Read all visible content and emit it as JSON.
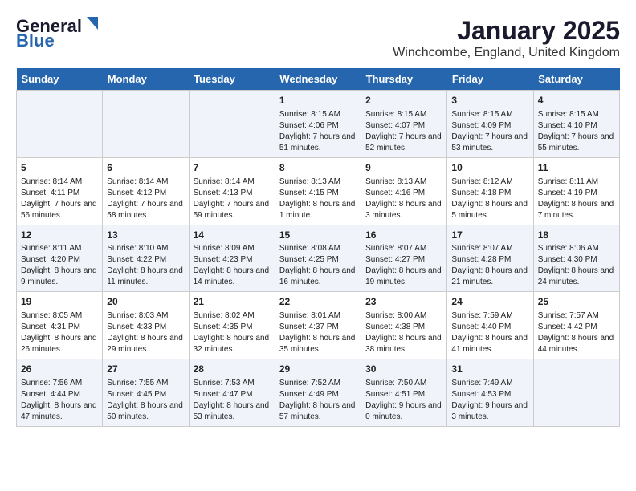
{
  "header": {
    "logo_general": "General",
    "logo_blue": "Blue",
    "title": "January 2025",
    "subtitle": "Winchcombe, England, United Kingdom"
  },
  "days_of_week": [
    "Sunday",
    "Monday",
    "Tuesday",
    "Wednesday",
    "Thursday",
    "Friday",
    "Saturday"
  ],
  "weeks": [
    [
      {
        "day": "",
        "info": ""
      },
      {
        "day": "",
        "info": ""
      },
      {
        "day": "",
        "info": ""
      },
      {
        "day": "1",
        "info": "Sunrise: 8:15 AM\nSunset: 4:06 PM\nDaylight: 7 hours and 51 minutes."
      },
      {
        "day": "2",
        "info": "Sunrise: 8:15 AM\nSunset: 4:07 PM\nDaylight: 7 hours and 52 minutes."
      },
      {
        "day": "3",
        "info": "Sunrise: 8:15 AM\nSunset: 4:09 PM\nDaylight: 7 hours and 53 minutes."
      },
      {
        "day": "4",
        "info": "Sunrise: 8:15 AM\nSunset: 4:10 PM\nDaylight: 7 hours and 55 minutes."
      }
    ],
    [
      {
        "day": "5",
        "info": "Sunrise: 8:14 AM\nSunset: 4:11 PM\nDaylight: 7 hours and 56 minutes."
      },
      {
        "day": "6",
        "info": "Sunrise: 8:14 AM\nSunset: 4:12 PM\nDaylight: 7 hours and 58 minutes."
      },
      {
        "day": "7",
        "info": "Sunrise: 8:14 AM\nSunset: 4:13 PM\nDaylight: 7 hours and 59 minutes."
      },
      {
        "day": "8",
        "info": "Sunrise: 8:13 AM\nSunset: 4:15 PM\nDaylight: 8 hours and 1 minute."
      },
      {
        "day": "9",
        "info": "Sunrise: 8:13 AM\nSunset: 4:16 PM\nDaylight: 8 hours and 3 minutes."
      },
      {
        "day": "10",
        "info": "Sunrise: 8:12 AM\nSunset: 4:18 PM\nDaylight: 8 hours and 5 minutes."
      },
      {
        "day": "11",
        "info": "Sunrise: 8:11 AM\nSunset: 4:19 PM\nDaylight: 8 hours and 7 minutes."
      }
    ],
    [
      {
        "day": "12",
        "info": "Sunrise: 8:11 AM\nSunset: 4:20 PM\nDaylight: 8 hours and 9 minutes."
      },
      {
        "day": "13",
        "info": "Sunrise: 8:10 AM\nSunset: 4:22 PM\nDaylight: 8 hours and 11 minutes."
      },
      {
        "day": "14",
        "info": "Sunrise: 8:09 AM\nSunset: 4:23 PM\nDaylight: 8 hours and 14 minutes."
      },
      {
        "day": "15",
        "info": "Sunrise: 8:08 AM\nSunset: 4:25 PM\nDaylight: 8 hours and 16 minutes."
      },
      {
        "day": "16",
        "info": "Sunrise: 8:07 AM\nSunset: 4:27 PM\nDaylight: 8 hours and 19 minutes."
      },
      {
        "day": "17",
        "info": "Sunrise: 8:07 AM\nSunset: 4:28 PM\nDaylight: 8 hours and 21 minutes."
      },
      {
        "day": "18",
        "info": "Sunrise: 8:06 AM\nSunset: 4:30 PM\nDaylight: 8 hours and 24 minutes."
      }
    ],
    [
      {
        "day": "19",
        "info": "Sunrise: 8:05 AM\nSunset: 4:31 PM\nDaylight: 8 hours and 26 minutes."
      },
      {
        "day": "20",
        "info": "Sunrise: 8:03 AM\nSunset: 4:33 PM\nDaylight: 8 hours and 29 minutes."
      },
      {
        "day": "21",
        "info": "Sunrise: 8:02 AM\nSunset: 4:35 PM\nDaylight: 8 hours and 32 minutes."
      },
      {
        "day": "22",
        "info": "Sunrise: 8:01 AM\nSunset: 4:37 PM\nDaylight: 8 hours and 35 minutes."
      },
      {
        "day": "23",
        "info": "Sunrise: 8:00 AM\nSunset: 4:38 PM\nDaylight: 8 hours and 38 minutes."
      },
      {
        "day": "24",
        "info": "Sunrise: 7:59 AM\nSunset: 4:40 PM\nDaylight: 8 hours and 41 minutes."
      },
      {
        "day": "25",
        "info": "Sunrise: 7:57 AM\nSunset: 4:42 PM\nDaylight: 8 hours and 44 minutes."
      }
    ],
    [
      {
        "day": "26",
        "info": "Sunrise: 7:56 AM\nSunset: 4:44 PM\nDaylight: 8 hours and 47 minutes."
      },
      {
        "day": "27",
        "info": "Sunrise: 7:55 AM\nSunset: 4:45 PM\nDaylight: 8 hours and 50 minutes."
      },
      {
        "day": "28",
        "info": "Sunrise: 7:53 AM\nSunset: 4:47 PM\nDaylight: 8 hours and 53 minutes."
      },
      {
        "day": "29",
        "info": "Sunrise: 7:52 AM\nSunset: 4:49 PM\nDaylight: 8 hours and 57 minutes."
      },
      {
        "day": "30",
        "info": "Sunrise: 7:50 AM\nSunset: 4:51 PM\nDaylight: 9 hours and 0 minutes."
      },
      {
        "day": "31",
        "info": "Sunrise: 7:49 AM\nSunset: 4:53 PM\nDaylight: 9 hours and 3 minutes."
      },
      {
        "day": "",
        "info": ""
      }
    ]
  ]
}
